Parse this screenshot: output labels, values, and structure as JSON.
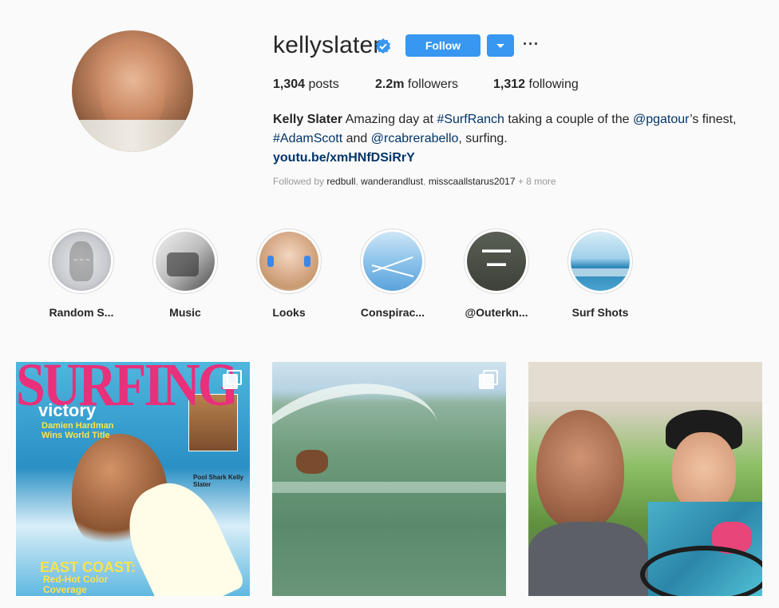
{
  "profile": {
    "username": "kellyslater",
    "verified": true,
    "follow_label": "Follow",
    "more_label": "···"
  },
  "stats": {
    "posts_count": "1,304",
    "posts_label": "posts",
    "followers_count": "2.2m",
    "followers_label": "followers",
    "following_count": "1,312",
    "following_label": "following"
  },
  "bio": {
    "name": "Kelly Slater",
    "text1": "Amazing day at",
    "tag1": "#SurfRanch",
    "text2": "taking a couple of the",
    "mention1": "@pgatour",
    "text3": "’s finest,",
    "tag2": "#AdamScott",
    "text4": "and",
    "mention2": "@rcabrerabello",
    "text5": ", surfing.",
    "link": "youtu.be/xmHNfDSiRrY"
  },
  "followed_by": {
    "prefix": "Followed by",
    "users": [
      "redbull",
      "wanderandlust",
      "misscaallstarus2017"
    ],
    "suffix": "+ 8 more"
  },
  "highlights": [
    {
      "label": "Random S..."
    },
    {
      "label": "Music"
    },
    {
      "label": "Looks"
    },
    {
      "label": "Conspirac..."
    },
    {
      "label": "@Outerkn..."
    },
    {
      "label": "Surf Shots"
    }
  ],
  "posts": [
    {
      "type": "magazine",
      "multi": true,
      "title": "SURFING",
      "sub1": "victory",
      "sub2": "Damien Hardman Wins World Title",
      "pool": "Pool Shark Kelly Slater",
      "east": "EAST COAST:",
      "east2": "Red-Hot Color Coverage"
    },
    {
      "type": "wave",
      "multi": true
    },
    {
      "type": "golfcart",
      "multi": false
    }
  ],
  "colors": {
    "accent": "#3897f0",
    "link": "#003569",
    "text": "#262626",
    "muted": "#999999",
    "background": "#fafafa"
  }
}
